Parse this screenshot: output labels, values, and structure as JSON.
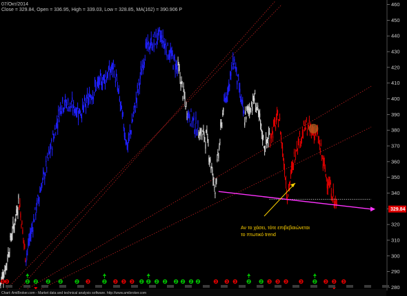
{
  "header": {
    "date": "07/Οκτ/2014",
    "ohlc_line": "Close = 329.84,   Open = 336.95,   High = 339.03,   Low = 328.85,  MA(162) = 390.906   P"
  },
  "footer": {
    "text": "Chart: AmiBroker.com - Market data and technical analysis software. http://www.amibroker.com"
  },
  "annotation": {
    "line1": "Αν το χάσει, τότε επιβεβαιώνεται",
    "line2": "το πτωτικό trend"
  },
  "colors": {
    "background": "#000000",
    "uptrend": "#2020ff",
    "downtrend": "#e00000",
    "neutral": "#d8d8d8",
    "trendline": "#ff33ff",
    "projection": "#c02020",
    "annotation": "#ffd200",
    "signal_buy": "#00c000",
    "signal_sell": "#e00000"
  },
  "chart_data": {
    "type": "candlestick",
    "title": "",
    "ylim": [
      278,
      462
    ],
    "yticks": [
      280,
      290,
      300,
      310,
      320,
      330,
      340,
      350,
      360,
      370,
      380,
      390,
      400,
      410,
      420,
      430,
      440,
      450,
      460
    ],
    "grid": false,
    "last_price": 329.84,
    "segments": [
      {
        "trend": "neutral",
        "from": 0,
        "to": 7,
        "start": 282,
        "end": 292
      },
      {
        "trend": "neutral",
        "from": 8,
        "to": 18,
        "start": 292,
        "end": 316
      },
      {
        "trend": "neutral",
        "from": 19,
        "to": 27,
        "start": 316,
        "end": 335
      },
      {
        "trend": "downtrend",
        "from": 28,
        "to": 37,
        "start": 335,
        "end": 300
      },
      {
        "trend": "uptrend",
        "from": 38,
        "to": 60,
        "start": 300,
        "end": 345
      },
      {
        "trend": "uptrend",
        "from": 61,
        "to": 90,
        "start": 345,
        "end": 398
      },
      {
        "trend": "uptrend",
        "from": 91,
        "to": 118,
        "start": 398,
        "end": 392
      },
      {
        "trend": "uptrend",
        "from": 119,
        "to": 140,
        "start": 392,
        "end": 408
      },
      {
        "trend": "uptrend",
        "from": 141,
        "to": 165,
        "start": 408,
        "end": 420
      },
      {
        "trend": "uptrend",
        "from": 166,
        "to": 185,
        "start": 420,
        "end": 370
      },
      {
        "trend": "uptrend",
        "from": 186,
        "to": 212,
        "start": 370,
        "end": 432
      },
      {
        "trend": "uptrend",
        "from": 213,
        "to": 232,
        "start": 432,
        "end": 440
      },
      {
        "trend": "uptrend",
        "from": 233,
        "to": 258,
        "start": 440,
        "end": 420
      },
      {
        "trend": "neutral",
        "from": 259,
        "to": 272,
        "start": 420,
        "end": 392
      },
      {
        "trend": "uptrend",
        "from": 273,
        "to": 288,
        "start": 392,
        "end": 380
      },
      {
        "trend": "neutral",
        "from": 289,
        "to": 300,
        "start": 380,
        "end": 375
      },
      {
        "trend": "neutral",
        "from": 301,
        "to": 312,
        "start": 375,
        "end": 344
      },
      {
        "trend": "neutral",
        "from": 313,
        "to": 325,
        "start": 344,
        "end": 395
      },
      {
        "trend": "uptrend",
        "from": 326,
        "to": 340,
        "start": 395,
        "end": 424
      },
      {
        "trend": "uptrend",
        "from": 341,
        "to": 355,
        "start": 424,
        "end": 388
      },
      {
        "trend": "neutral",
        "from": 356,
        "to": 370,
        "start": 388,
        "end": 400
      },
      {
        "trend": "neutral",
        "from": 371,
        "to": 385,
        "start": 400,
        "end": 370
      },
      {
        "trend": "neutral",
        "from": 386,
        "to": 392,
        "start": 370,
        "end": 376
      },
      {
        "trend": "downtrend",
        "from": 393,
        "to": 405,
        "start": 376,
        "end": 388
      },
      {
        "trend": "downtrend",
        "from": 406,
        "to": 418,
        "start": 388,
        "end": 340
      },
      {
        "trend": "downtrend",
        "from": 419,
        "to": 432,
        "start": 340,
        "end": 372
      },
      {
        "trend": "downtrend",
        "from": 433,
        "to": 445,
        "start": 372,
        "end": 382
      },
      {
        "trend": "downtrend",
        "from": 446,
        "to": 460,
        "start": 382,
        "end": 378
      },
      {
        "trend": "downtrend",
        "from": 461,
        "to": 475,
        "start": 378,
        "end": 350
      },
      {
        "trend": "downtrend",
        "from": 476,
        "to": 490,
        "start": 350,
        "end": 330
      }
    ],
    "trendline": {
      "from": [
        318,
        341
      ],
      "to": [
        540,
        329.8
      ]
    },
    "support_level": {
      "from": [
        392,
        336
      ],
      "to": [
        540,
        336
      ]
    },
    "projection_lines": [
      {
        "from": [
          10,
          279
        ],
        "to": [
          410,
          460
        ]
      },
      {
        "from": [
          28,
          279
        ],
        "to": [
          400,
          462
        ]
      },
      {
        "from": [
          40,
          279
        ],
        "to": [
          540,
          408
        ]
      },
      {
        "from": [
          60,
          279
        ],
        "to": [
          540,
          382
        ]
      }
    ],
    "signals": [
      {
        "x": 4,
        "type": "sell"
      },
      {
        "x": 10,
        "type": "sell"
      },
      {
        "x": 40,
        "type": "buy"
      },
      {
        "x": 52,
        "type": "buy"
      },
      {
        "x": 70,
        "type": "buy"
      },
      {
        "x": 88,
        "type": "buy"
      },
      {
        "x": 112,
        "type": "buy"
      },
      {
        "x": 128,
        "type": "sell"
      },
      {
        "x": 152,
        "type": "buy"
      },
      {
        "x": 168,
        "type": "sell"
      },
      {
        "x": 180,
        "type": "sell"
      },
      {
        "x": 192,
        "type": "sell"
      },
      {
        "x": 206,
        "type": "buy"
      },
      {
        "x": 216,
        "type": "buy"
      },
      {
        "x": 228,
        "type": "buy"
      },
      {
        "x": 240,
        "type": "buy"
      },
      {
        "x": 256,
        "type": "buy"
      },
      {
        "x": 266,
        "type": "buy"
      },
      {
        "x": 278,
        "type": "buy"
      },
      {
        "x": 288,
        "type": "buy"
      },
      {
        "x": 314,
        "type": "sell"
      },
      {
        "x": 330,
        "type": "sell"
      },
      {
        "x": 342,
        "type": "sell"
      },
      {
        "x": 362,
        "type": "buy"
      },
      {
        "x": 380,
        "type": "buy"
      },
      {
        "x": 392,
        "type": "sell"
      },
      {
        "x": 404,
        "type": "sell"
      },
      {
        "x": 416,
        "type": "sell"
      },
      {
        "x": 438,
        "type": "sell"
      },
      {
        "x": 458,
        "type": "buy"
      },
      {
        "x": 474,
        "type": "sell"
      },
      {
        "x": 486,
        "type": "sell"
      },
      {
        "x": 500,
        "type": "sell"
      }
    ],
    "buy_arrows": [
      40,
      152,
      216,
      362,
      458
    ],
    "sell_arrows": [
      52,
      486
    ],
    "circle_marker": {
      "x": 456,
      "y": 381
    }
  }
}
